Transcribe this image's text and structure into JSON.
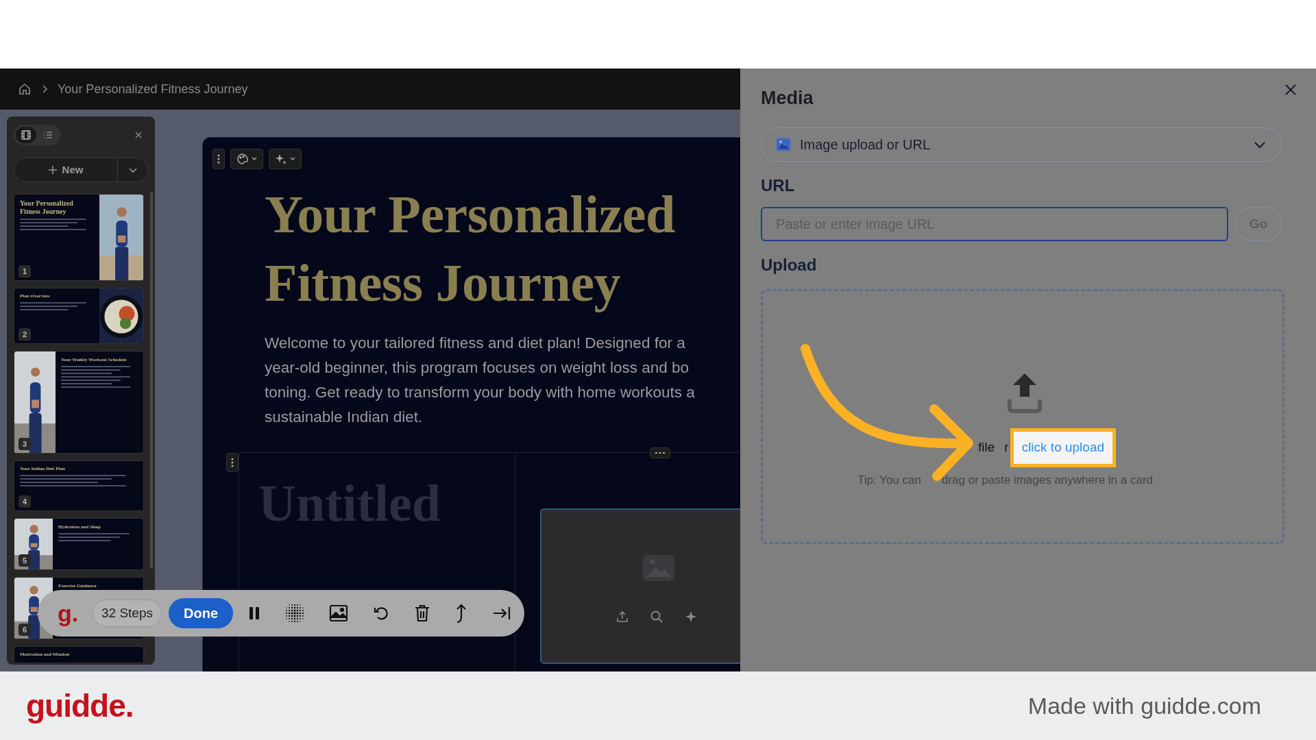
{
  "breadcrumb": {
    "title": "Your Personalized Fitness Journey"
  },
  "slides_panel": {
    "view_tabs": [
      {
        "kind": "grid",
        "selected": true
      },
      {
        "kind": "list",
        "selected": false
      }
    ],
    "new_button": "New",
    "slides": [
      {
        "number": "1",
        "title": "Your Personalized Fitness Journey",
        "kind": "photo_right"
      },
      {
        "number": "2",
        "title": "Plan Overview",
        "kind": "photo_right"
      },
      {
        "number": "3",
        "title": "Your Weekly Workout Schedule",
        "kind": "photo_left"
      },
      {
        "number": "4",
        "title": "Your Indian Diet Plan",
        "kind": "text"
      },
      {
        "number": "5",
        "title": "Hydration and Sleep",
        "kind": "photo_left"
      },
      {
        "number": "6",
        "title": "Exercise Guidance",
        "kind": "photo_left"
      },
      {
        "title": "Motivation and Mindset",
        "kind": "text"
      }
    ]
  },
  "slide": {
    "title_lines": [
      "Your Personalized",
      "Fitness Journey"
    ],
    "paragraph_lines": [
      "Welcome to your tailored fitness and diet plan! Designed for a",
      "year-old beginner, this program focuses on weight loss and bo",
      "toning. Get ready to transform your body with home workouts a",
      "sustainable Indian diet."
    ],
    "placeholder_title": "Untitled"
  },
  "media_panel": {
    "title": "Media",
    "source": "Image upload or URL",
    "url_label": "URL",
    "url_placeholder": "Paste or enter image URL",
    "go_button": "Go",
    "upload_label": "Upload",
    "drop_parts": [
      "file",
      "r"
    ],
    "link": "click to upload",
    "tip_parts": [
      "Tip: You can",
      "drag or paste images anywhere in a card"
    ]
  },
  "recorder_toolbar": {
    "logo": "g.",
    "steps": "32 Steps",
    "done": "Done"
  },
  "footer": {
    "logo": "guidde.",
    "credit": "Made with guidde.com"
  }
}
